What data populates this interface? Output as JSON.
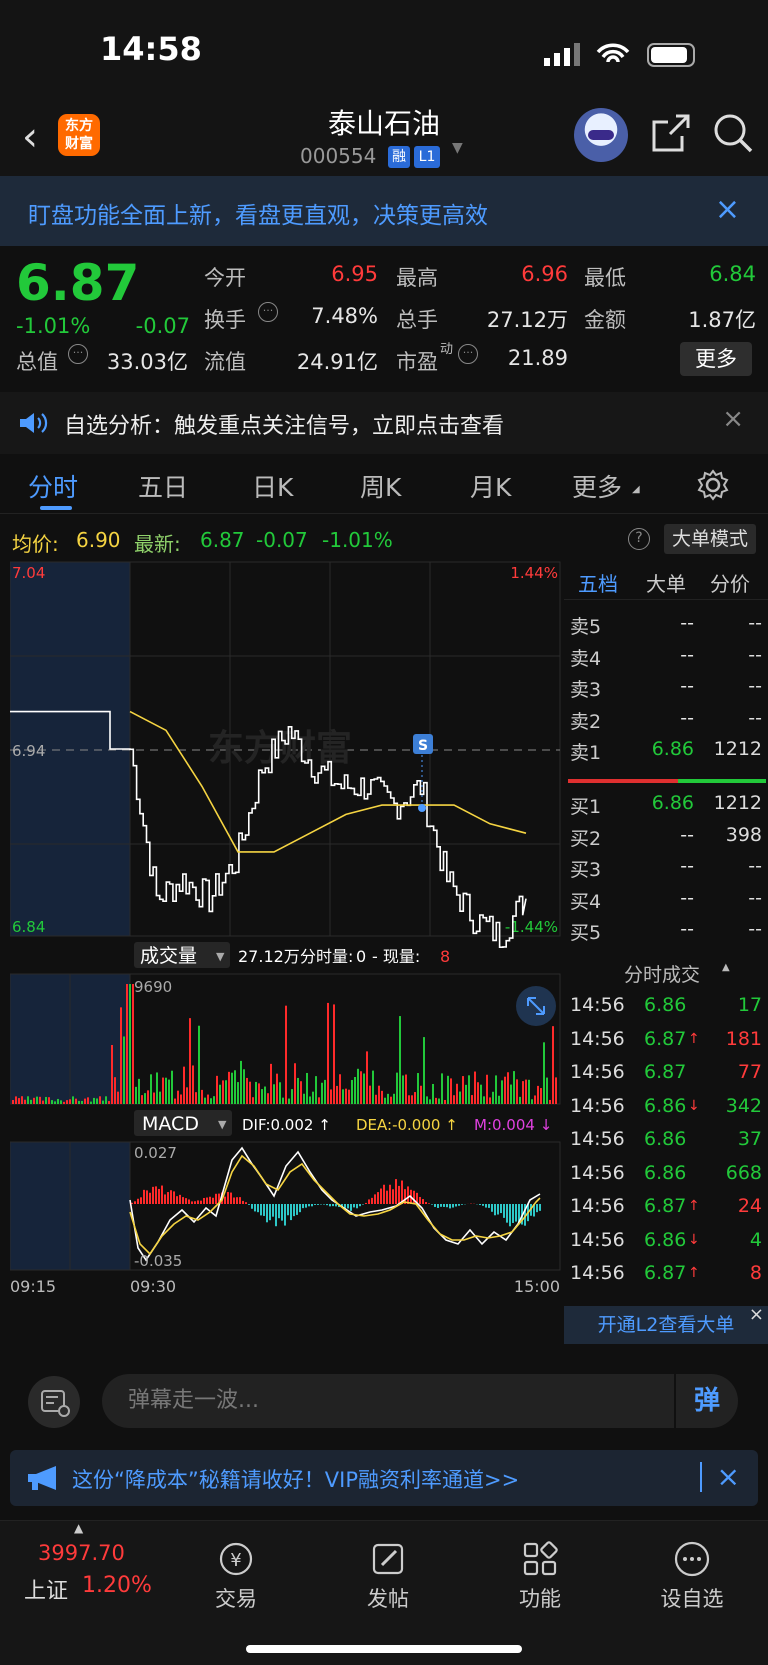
{
  "status": {
    "time": "14:58"
  },
  "header": {
    "logo_line1": "东方",
    "logo_line2": "财富",
    "name": "泰山石油",
    "code": "000554",
    "badge_rong": "融",
    "badge_l1": "L1"
  },
  "banner_top": {
    "text": "盯盘功能全面上新，看盘更直观，决策更高效",
    "close": "×"
  },
  "quote": {
    "price": "6.87",
    "change_pct": "-1.01%",
    "change": "-0.07",
    "open_label": "今开",
    "open": "6.95",
    "high_label": "最高",
    "high": "6.96",
    "low_label": "最低",
    "low": "6.84",
    "turnover_label": "换手",
    "turnover": "7.48%",
    "volume_label": "总手",
    "volume": "27.12万",
    "amount_label": "金额",
    "amount": "1.87亿",
    "mktcap_label": "总值",
    "mktcap": "33.03亿",
    "float_label": "流值",
    "float": "24.91亿",
    "pe_label": "市盈",
    "pe_sup": "动",
    "pe": "21.89",
    "more": "更多"
  },
  "banner_analysis": {
    "text": "自选分析：触发重点关注信号，立即点击查看",
    "close": "×"
  },
  "tabs": [
    "分时",
    "五日",
    "日K",
    "周K",
    "月K",
    "更多"
  ],
  "infoline": {
    "avg_label": "均价:",
    "avg": "6.90",
    "latest_label": "最新:",
    "latest": "6.87",
    "latest_chg": "-0.07",
    "latest_pct": "-1.01%",
    "mode_btn": "大单模式"
  },
  "chart": {
    "price_top": "7.04",
    "price_mid": "6.94",
    "price_bottom": "6.84",
    "pct_top": "1.44%",
    "pct_bottom": "-1.44%",
    "watermark": "东方财富",
    "marker": "S",
    "vol_selector": "成交量",
    "vol_total": "27.12万",
    "vol_split_label": "分时量:",
    "vol_split": "0",
    "vol_now_label": "- 现量:",
    "vol_now": "8",
    "vol_max": "9690",
    "macd_selector": "MACD",
    "dif": "DIF:0.002 ↑",
    "dea": "DEA:-0.000 ↑",
    "m": "M:0.004 ↓",
    "macd_top": "0.027",
    "macd_bottom": "-0.035",
    "time_start": "09:15",
    "time_open": "09:30",
    "time_end": "15:00"
  },
  "chart_data": {
    "type": "line",
    "title": "",
    "x_ticks": [
      "09:15",
      "09:30",
      "15:00"
    ],
    "ylim": [
      6.84,
      7.04
    ],
    "series": [
      {
        "values": [
          6.96,
          6.96,
          6.96,
          6.94,
          6.86,
          6.87,
          6.86,
          6.88,
          6.93,
          6.95,
          6.93,
          6.92,
          6.92,
          6.91,
          6.92,
          6.87,
          6.85,
          6.84,
          6.86
        ]
      },
      {
        "values": [
          6.96,
          6.95,
          6.92,
          6.885,
          6.885,
          6.895,
          6.905,
          6.91,
          6.91,
          6.91,
          6.9,
          6.895
        ]
      }
    ]
  },
  "book": {
    "tabs": [
      "五档",
      "大单",
      "分价"
    ],
    "asks": [
      {
        "label": "卖5",
        "price": "--",
        "vol": "--"
      },
      {
        "label": "卖4",
        "price": "--",
        "vol": "--"
      },
      {
        "label": "卖3",
        "price": "--",
        "vol": "--"
      },
      {
        "label": "卖2",
        "price": "--",
        "vol": "--"
      },
      {
        "label": "卖1",
        "price": "6.86",
        "vol": "1212"
      }
    ],
    "bids": [
      {
        "label": "买1",
        "price": "6.86",
        "vol": "1212"
      },
      {
        "label": "买2",
        "price": "--",
        "vol": "398"
      },
      {
        "label": "买3",
        "price": "--",
        "vol": "--"
      },
      {
        "label": "买4",
        "price": "--",
        "vol": "--"
      },
      {
        "label": "买5",
        "price": "--",
        "vol": "--"
      }
    ],
    "trades_title": "分时成交",
    "trades": [
      {
        "time": "14:56",
        "price": "6.86",
        "arrow": "",
        "vol": "17",
        "pc": "green",
        "vc": "green"
      },
      {
        "time": "14:56",
        "price": "6.87",
        "arrow": "↑",
        "vol": "181",
        "pc": "green",
        "vc": "red"
      },
      {
        "time": "14:56",
        "price": "6.87",
        "arrow": "",
        "vol": "77",
        "pc": "green",
        "vc": "red"
      },
      {
        "time": "14:56",
        "price": "6.86",
        "arrow": "↓",
        "vol": "342",
        "pc": "green",
        "vc": "green"
      },
      {
        "time": "14:56",
        "price": "6.86",
        "arrow": "",
        "vol": "37",
        "pc": "green",
        "vc": "green"
      },
      {
        "time": "14:56",
        "price": "6.86",
        "arrow": "",
        "vol": "668",
        "pc": "green",
        "vc": "green"
      },
      {
        "time": "14:56",
        "price": "6.87",
        "arrow": "↑",
        "vol": "24",
        "pc": "green",
        "vc": "red"
      },
      {
        "time": "14:56",
        "price": "6.86",
        "arrow": "↓",
        "vol": "4",
        "pc": "green",
        "vc": "green"
      },
      {
        "time": "14:56",
        "price": "6.87",
        "arrow": "↑",
        "vol": "8",
        "pc": "green",
        "vc": "red"
      }
    ],
    "l2": "开通L2查看大单"
  },
  "danmu": {
    "placeholder": "弹幕走一波...",
    "send": "弹"
  },
  "promo": {
    "text": "这份“降成本”秘籍请收好！VIP融资利率通道>>",
    "close": "×"
  },
  "nav": {
    "index_value": "3997.70",
    "index_name": "上证",
    "index_pct": "1.20%",
    "items": [
      "交易",
      "发帖",
      "功能",
      "设自选"
    ]
  }
}
